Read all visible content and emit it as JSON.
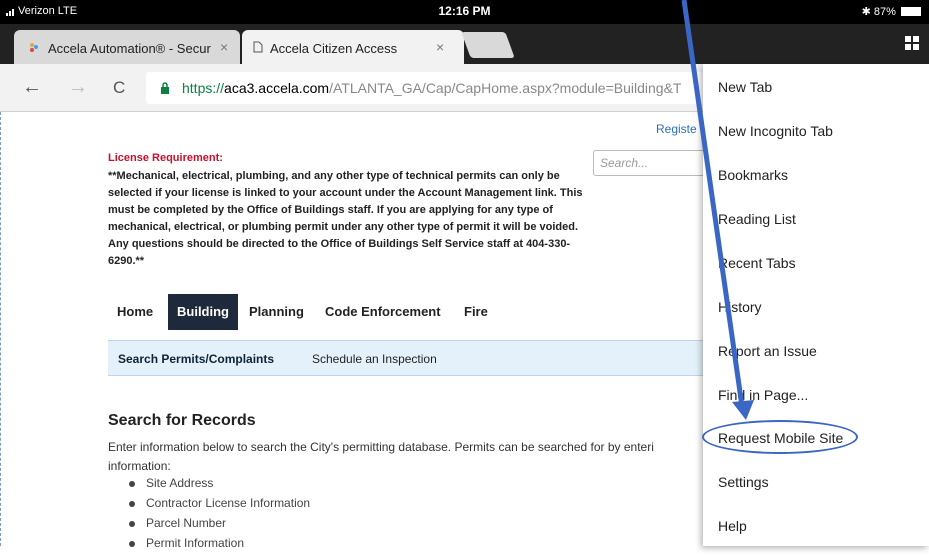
{
  "status_bar": {
    "carrier": "Verizon  LTE",
    "time": "12:16 PM",
    "battery": "✱ 87%"
  },
  "tabs": [
    {
      "title": "Accela Automation® - Secur",
      "close": "×",
      "active": false
    },
    {
      "title": "Accela Citizen Access",
      "close": "×",
      "active": true
    }
  ],
  "toolbar": {
    "back": "←",
    "forward": "→",
    "reload": "C",
    "url_scheme": "https://",
    "url_host": "aca3.accela.com",
    "url_path": "/ATLANTA_GA/Cap/CapHome.aspx?module=Building&T"
  },
  "page": {
    "register": "Registe",
    "search_placeholder": "Search...",
    "license_title": "License Requirement:",
    "license_text": "**Mechanical, electrical, plumbing, and any other type of technical permits can only be selected if your license is linked to your account under the Account Management link. This must be completed by the Office of Buildings staff. If you are applying for any type of mechanical, electrical, or plumbing permit under any other type of permit it will be voided.  Any questions should be directed to the Office of Buildings Self Service staff at 404-330-6290.**",
    "nav": [
      "Home",
      "Building",
      "Planning",
      "Code Enforcement",
      "Fire"
    ],
    "subnav": [
      "Search Permits/Complaints",
      "Schedule an Inspection"
    ],
    "search_title": "Search for Records",
    "search_desc": "Enter information below to search the City's permitting database. Permits can be searched for by enteri information:",
    "search_items": [
      "Site Address",
      "Contractor License Information",
      "Parcel Number",
      "Permit Information"
    ]
  },
  "menu": {
    "items": [
      "New Tab",
      "New Incognito Tab",
      "Bookmarks",
      "Reading List",
      "Recent Tabs",
      "History",
      "Report an Issue",
      "Find in Page...",
      "Request Mobile Site",
      "Settings",
      "Help"
    ]
  },
  "colors": {
    "accent": "#3a66c4",
    "nav_active": "#1e2a3b",
    "license_red": "#c8102e"
  }
}
